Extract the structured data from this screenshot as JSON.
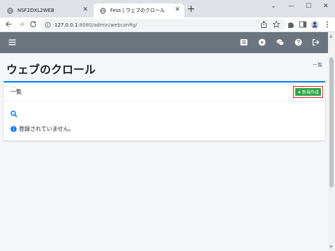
{
  "browser": {
    "tabs": [
      {
        "title": "NSF2DXL2WEB",
        "active": false
      },
      {
        "title": "Fess | ウェブのクロール",
        "active": true
      }
    ],
    "url_host": "127.0.0.1",
    "url_path": ":8080/admin/webconfig/",
    "new_tab_symbol": "+",
    "close_symbol": "✕",
    "window_controls": {
      "minimize": "—",
      "maximize": "☐",
      "close": "✕"
    },
    "collapse_symbol": "⌄"
  },
  "navbar": {
    "icons": [
      "hamburger-icon",
      "list-icon",
      "play-icon",
      "comments-icon",
      "question-icon",
      "sign-out-icon"
    ],
    "color": "#6c757d"
  },
  "page": {
    "title": "ウェブのクロール",
    "breadcrumb": "一覧"
  },
  "card": {
    "title": "一覧",
    "create_label": "新規作成",
    "create_plus": "+",
    "empty_message": "登録されていません。"
  },
  "colors": {
    "accent": "#007bff",
    "success": "#28a745",
    "highlight": "#e02020"
  }
}
